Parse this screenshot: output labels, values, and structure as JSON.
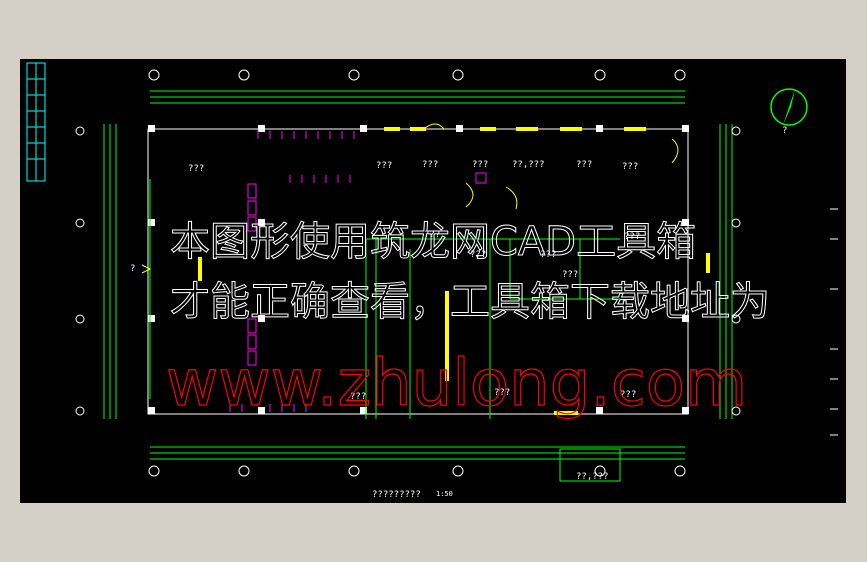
{
  "drawing": {
    "title_block": "?????????",
    "scale": "1:50",
    "north_label": "?",
    "unknown_label": "???",
    "room_labels": [
      "???",
      "???",
      "???",
      "???",
      "???",
      "???",
      "???",
      "???",
      "???",
      "???",
      "??,???",
      "??,???",
      "???",
      "???",
      "???",
      "???"
    ],
    "side_label": "?"
  },
  "watermark": {
    "line1": "本图形使用筑龙网CAD工具箱",
    "line2": "才能正确查看，工具箱下载地址为",
    "line3": "www.zhulong.com"
  },
  "colors": {
    "background_outer": "#d4d0c8",
    "background_canvas": "#000000",
    "line_white": "#ffffff",
    "line_green": "#00ff00",
    "line_yellow": "#ffff00",
    "line_magenta": "#ff00ff",
    "line_cyan": "#00ffff",
    "watermark_red": "#ff0000",
    "watermark_white": "#ffffff"
  }
}
